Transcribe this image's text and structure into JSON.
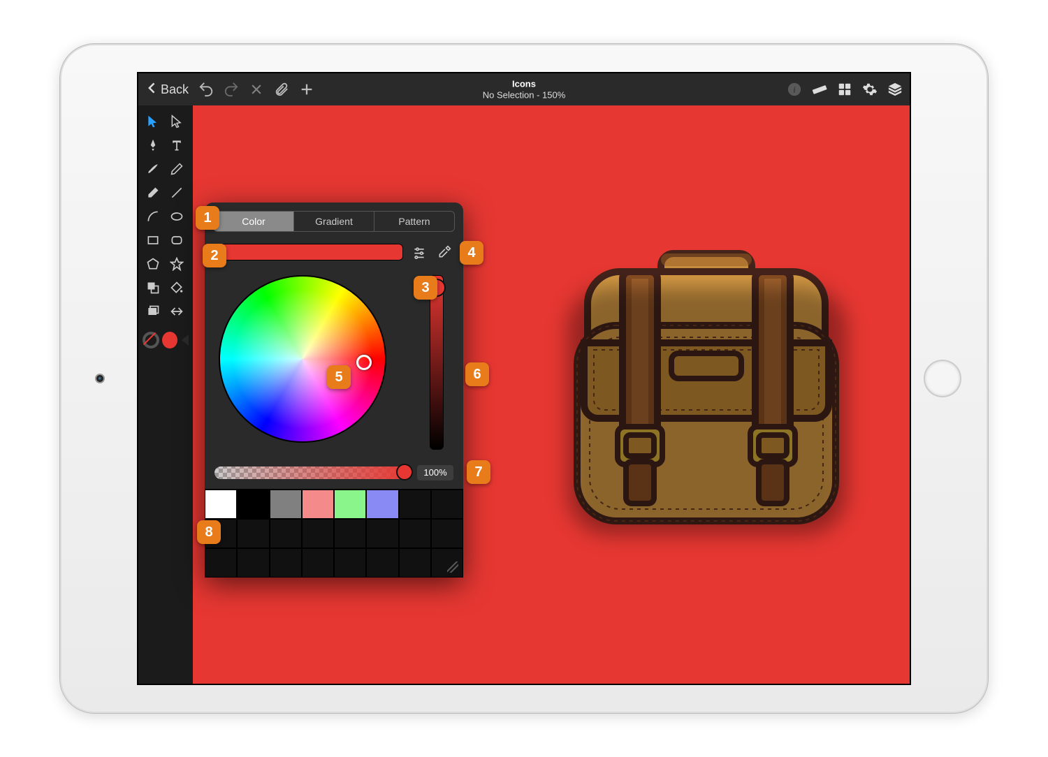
{
  "topbar": {
    "back_label": "Back",
    "title": "Icons",
    "subtitle": "No Selection - 150%"
  },
  "color_popover": {
    "tabs": {
      "color": "Color",
      "gradient": "Gradient",
      "pattern": "Pattern"
    },
    "current_color": "#e63732",
    "opacity_label": "100%",
    "swatches": [
      "#ffffff",
      "#000000",
      "#808080",
      "#f58a8a",
      "#8af58a",
      "#8a8af5"
    ]
  },
  "callouts": {
    "c1": "1",
    "c2": "2",
    "c3": "3",
    "c4": "4",
    "c5": "5",
    "c6": "6",
    "c7": "7",
    "c8": "8"
  },
  "canvas": {
    "bg": "#e63732"
  }
}
